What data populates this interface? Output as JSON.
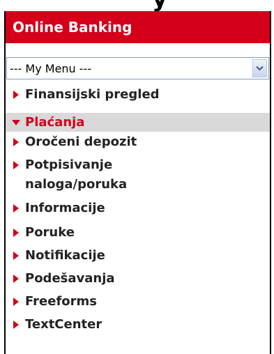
{
  "header": {
    "title": "Online Banking"
  },
  "menu_select": {
    "value": "--- My Menu ---"
  },
  "nav": {
    "items": [
      {
        "label": "Finansijski pregled",
        "active": false
      },
      {
        "label": "Plaćanja",
        "active": true
      },
      {
        "label": "Oročeni depozit",
        "active": false
      },
      {
        "label": "Potpisivanje naloga/poruka",
        "active": false
      },
      {
        "label": "Informacije",
        "active": false
      },
      {
        "label": "Poruke",
        "active": false
      },
      {
        "label": "Notifikacije",
        "active": false
      },
      {
        "label": "Podešavanja",
        "active": false
      },
      {
        "label": "Freeforms",
        "active": false
      },
      {
        "label": "TextCenter",
        "active": false
      }
    ]
  },
  "colors": {
    "brand_red": "#d4001a",
    "active_bg": "#d9d9d9"
  },
  "icons": {
    "collapsed": "caret-right-icon",
    "expanded": "caret-down-icon",
    "dropdown": "chevron-down-icon"
  }
}
